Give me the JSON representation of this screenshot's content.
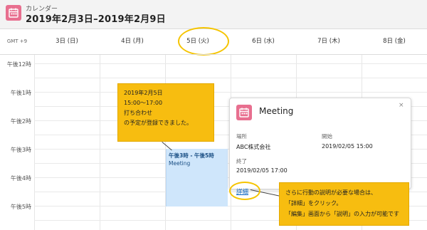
{
  "header": {
    "app_label": "カレンダー",
    "range_title": "2019年2月3日–2019年2月9日",
    "icon": "calendar-icon"
  },
  "grid": {
    "timezone": "GMT +9",
    "days": [
      "3日 (日)",
      "4日 (月)",
      "5日 (火)",
      "6日 (水)",
      "7日 (木)",
      "8日 (金)"
    ],
    "times": [
      "午後12時",
      "午後1時",
      "午後2時",
      "午後3時",
      "午後4時",
      "午後5時"
    ]
  },
  "event": {
    "time": "午後3時 - 午後5時",
    "name": "Meeting",
    "color": "#cfe6fb"
  },
  "popup": {
    "title": "Meeting",
    "close": "×",
    "location_label": "場所",
    "location_value": "ABC株式会社",
    "start_label": "開始",
    "start_value": "2019/02/05 15:00",
    "end_label": "終了",
    "end_value": "2019/02/05 17:00",
    "detail_link": "詳細"
  },
  "notes": {
    "note1_lines": [
      "2019年2月5日",
      "15:00～17:00",
      "打ち合わせ",
      "の予定が登録できました。"
    ],
    "note2_lines": [
      "さらに行動の説明が必要な場合は、",
      "「詳細」をクリック。",
      "「編集」画面から「説明」の入力が可能です"
    ]
  },
  "colors": {
    "accent_pink": "#e86f8f",
    "highlight_yellow": "#f7bd10",
    "link_blue": "#0b65c2"
  }
}
